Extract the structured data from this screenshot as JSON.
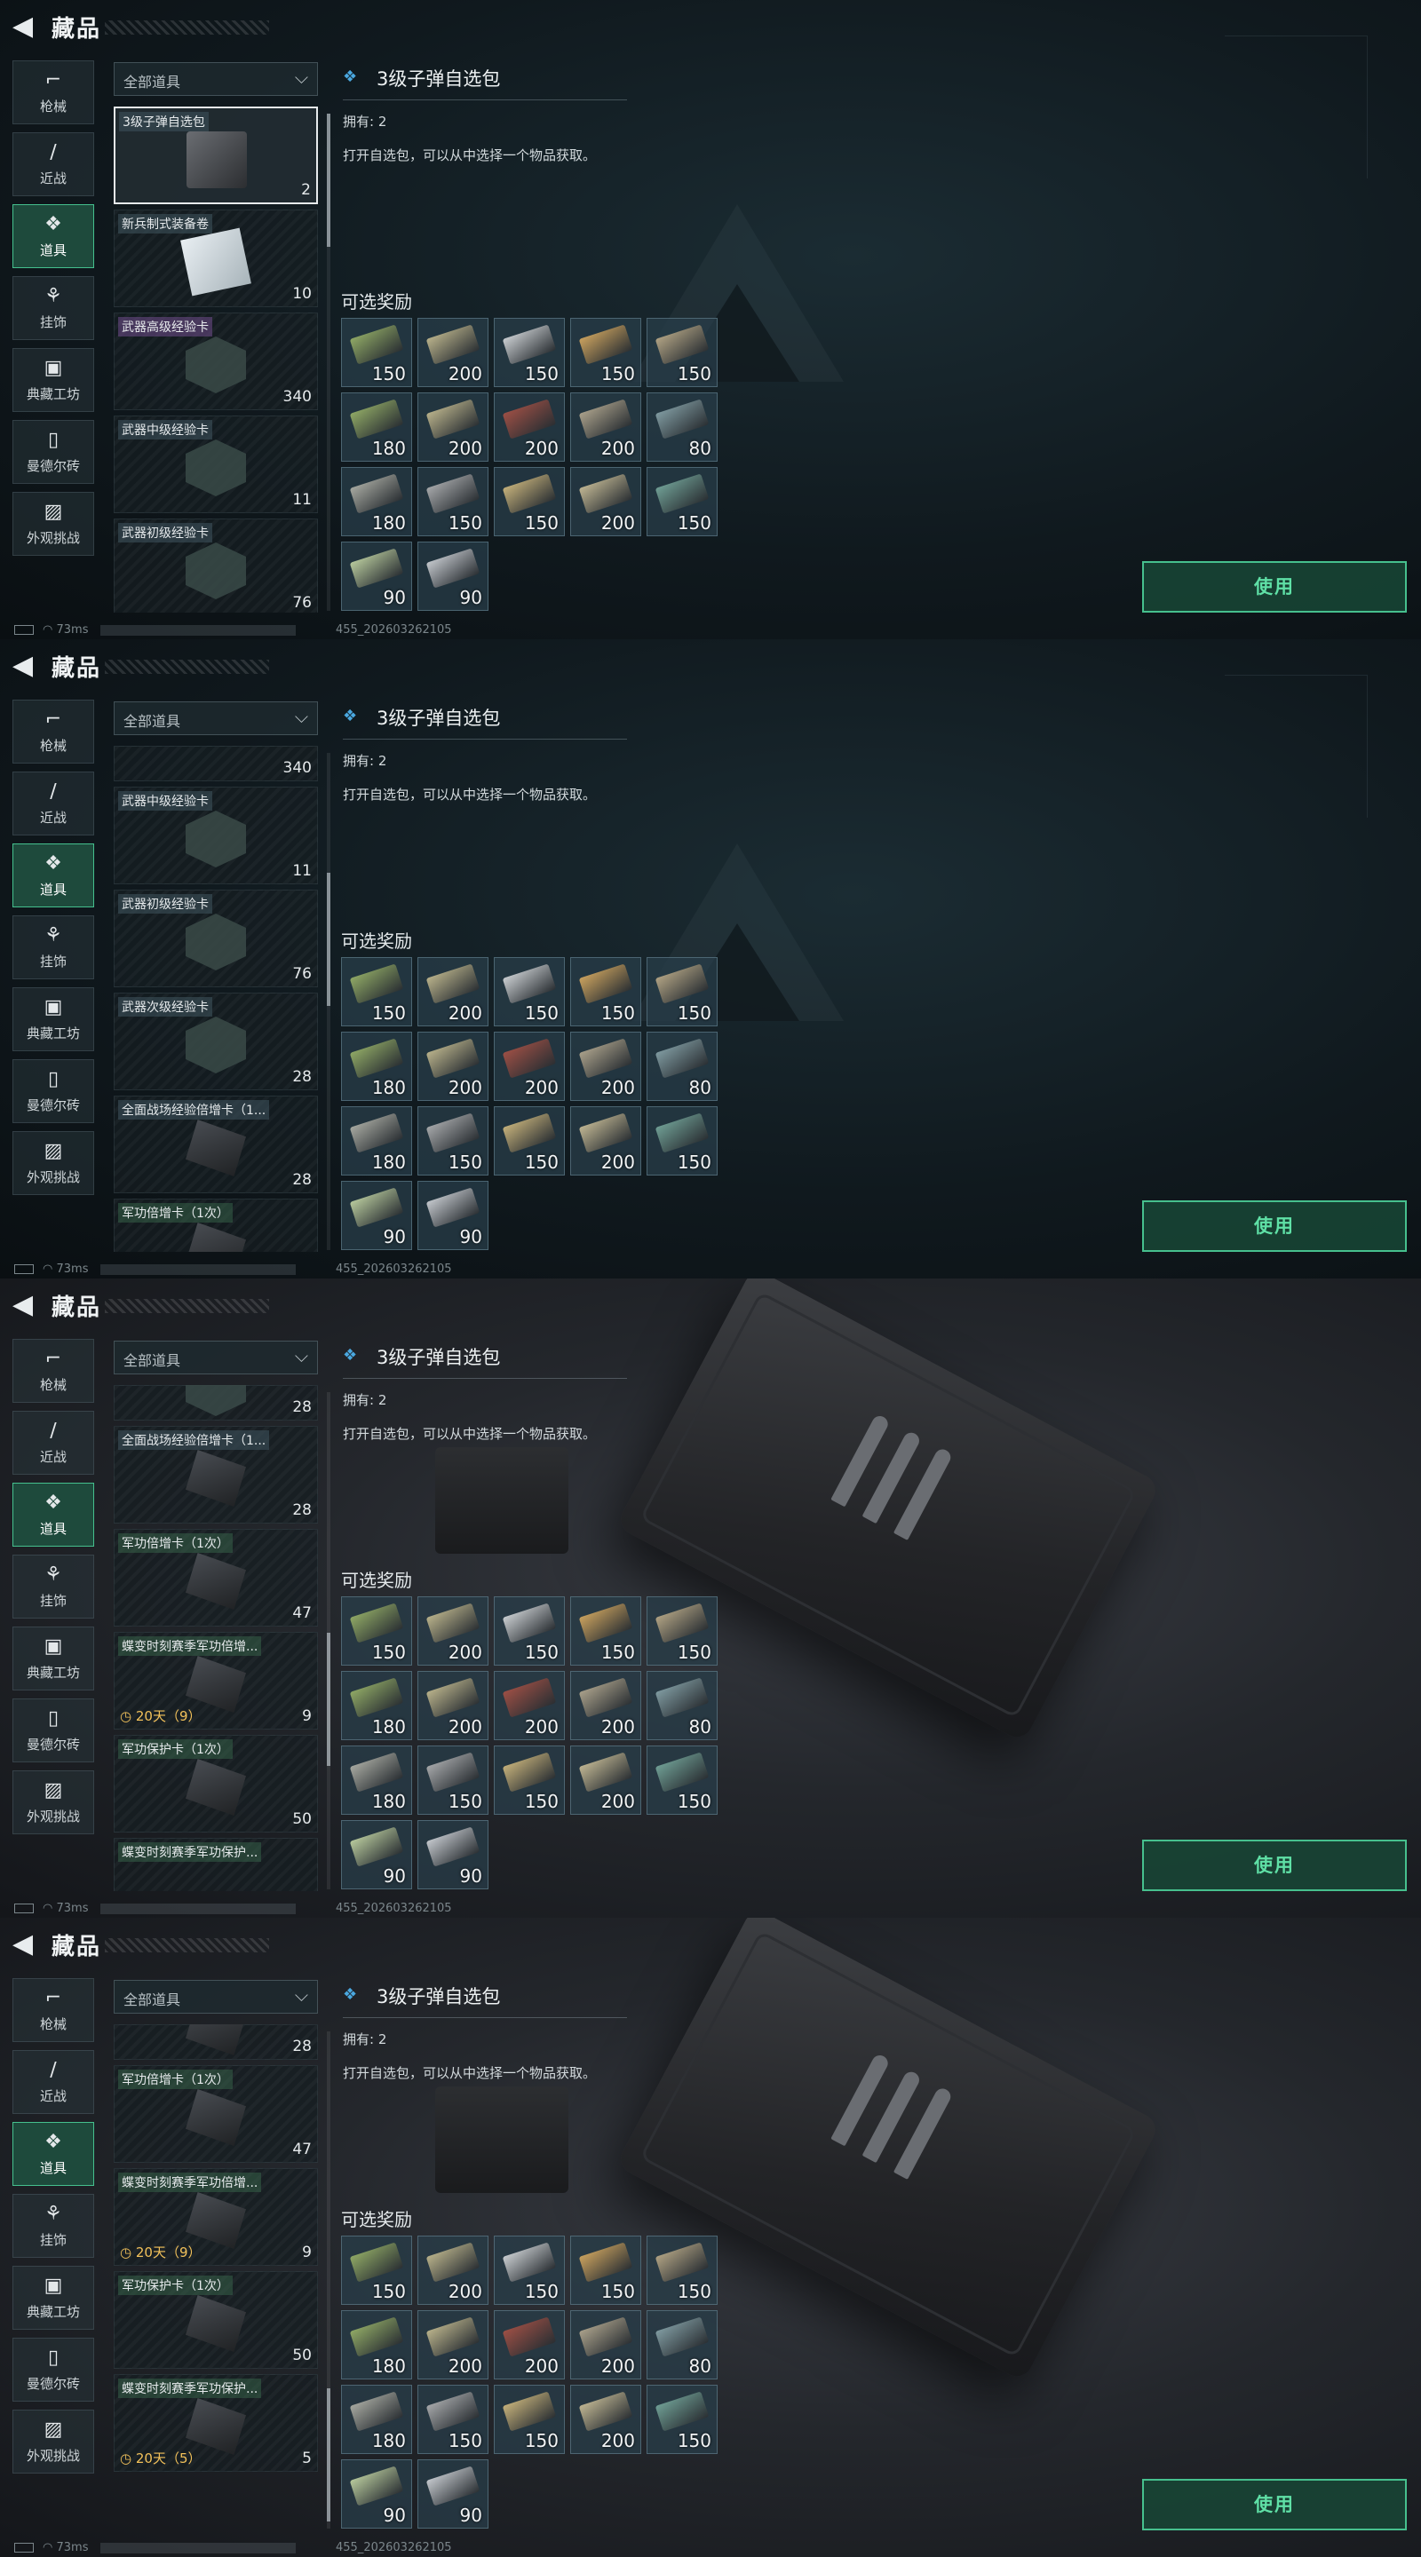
{
  "title": "藏品",
  "dropdown": "全部道具",
  "categories": [
    {
      "label": "枪械",
      "icon": "pistol-icon"
    },
    {
      "label": "近战",
      "icon": "knife-icon"
    },
    {
      "label": "道具",
      "icon": "items-icon",
      "active": true
    },
    {
      "label": "挂饰",
      "icon": "charm-icon"
    },
    {
      "label": "典藏工坊",
      "icon": "workshop-icon"
    },
    {
      "label": "曼德尔砖",
      "icon": "brick-icon"
    },
    {
      "label": "外观挑战",
      "icon": "appearance-icon"
    }
  ],
  "detail": {
    "title": "3级子弹自选包",
    "owned": "拥有: 2",
    "description": "打开自选包，可以从中选择一个物品获取。",
    "rewards_title": "可选奖励",
    "use_label": "使用"
  },
  "rewards": [
    {
      "value": "150",
      "color": "#8fa865"
    },
    {
      "value": "200",
      "color": "#b8b18a"
    },
    {
      "value": "150",
      "color": "#c9cdd0"
    },
    {
      "value": "150",
      "color": "#c9a15e"
    },
    {
      "value": "150",
      "color": "#b0a283"
    },
    {
      "value": "180",
      "color": "#8fa865"
    },
    {
      "value": "200",
      "color": "#b8b18a"
    },
    {
      "value": "200",
      "color": "#9c4f45"
    },
    {
      "value": "200",
      "color": "#a9a08a"
    },
    {
      "value": "80",
      "color": "#7f9aa0"
    },
    {
      "value": "180",
      "color": "#a6a8a0"
    },
    {
      "value": "150",
      "color": "#a5a7a9"
    },
    {
      "value": "150",
      "color": "#c4b07a"
    },
    {
      "value": "200",
      "color": "#bfb592"
    },
    {
      "value": "150",
      "color": "#6f9e94"
    },
    {
      "value": "90",
      "color": "#b7c99c"
    },
    {
      "value": "90",
      "color": "#c3c7cc"
    }
  ],
  "status": {
    "latency": "73ms",
    "code": "455_202603262105"
  },
  "frames": [
    {
      "bg": "dark",
      "scroll_thumb_pos": 0.0,
      "items": [
        {
          "name": "3级子弹自选包",
          "count": "2",
          "img": "box",
          "selected": true
        },
        {
          "name": "新兵制式装备卷",
          "count": "10",
          "img": "paper"
        },
        {
          "name": "武器高级经验卡",
          "count": "340",
          "img": "hex",
          "tag": "purple"
        },
        {
          "name": "武器中级经验卡",
          "count": "11",
          "img": "hex"
        },
        {
          "name": "武器初级经验卡",
          "count": "76",
          "img": "hex"
        }
      ]
    },
    {
      "bg": "dark",
      "scroll_thumb_pos": 0.33,
      "items": [
        {
          "name": "",
          "count": "340",
          "img": "none",
          "partial": true
        },
        {
          "name": "武器中级经验卡",
          "count": "11",
          "img": "hex"
        },
        {
          "name": "武器初级经验卡",
          "count": "76",
          "img": "hex"
        },
        {
          "name": "武器次级经验卡",
          "count": "28",
          "img": "hex"
        },
        {
          "name": "全面战场经验倍增卡（1...",
          "count": "28",
          "img": "crate-s"
        },
        {
          "name": "军功倍增卡（1次）",
          "count": "",
          "img": "crate-s",
          "tag": "green"
        }
      ]
    },
    {
      "bg": "photo",
      "scroll_thumb_pos": 0.66,
      "items": [
        {
          "name": "",
          "count": "28",
          "img": "hex",
          "partial": true
        },
        {
          "name": "全面战场经验倍增卡（1...",
          "count": "28",
          "img": "crate-s"
        },
        {
          "name": "军功倍增卡（1次）",
          "count": "47",
          "img": "crate-s",
          "tag": "green"
        },
        {
          "name": "蝶变时刻赛季军功倍增...",
          "count": "9",
          "img": "crate-s",
          "tag": "green",
          "timer": "20天（9）"
        },
        {
          "name": "军功保护卡（1次）",
          "count": "50",
          "img": "crate-s",
          "tag": "green"
        },
        {
          "name": "蝶变时刻赛季军功保护...",
          "count": "",
          "img": "none",
          "tag": "green"
        }
      ]
    },
    {
      "bg": "photo",
      "scroll_thumb_pos": 0.98,
      "items": [
        {
          "name": "",
          "count": "28",
          "img": "crate-s",
          "partial": true
        },
        {
          "name": "军功倍增卡（1次）",
          "count": "47",
          "img": "crate-s",
          "tag": "green"
        },
        {
          "name": "蝶变时刻赛季军功倍增...",
          "count": "9",
          "img": "crate-s",
          "tag": "green",
          "timer": "20天（9）"
        },
        {
          "name": "军功保护卡（1次）",
          "count": "50",
          "img": "crate-s",
          "tag": "green"
        },
        {
          "name": "蝶变时刻赛季军功保护...",
          "count": "5",
          "img": "crate-s",
          "tag": "green",
          "timer": "20天（5）"
        }
      ]
    }
  ]
}
